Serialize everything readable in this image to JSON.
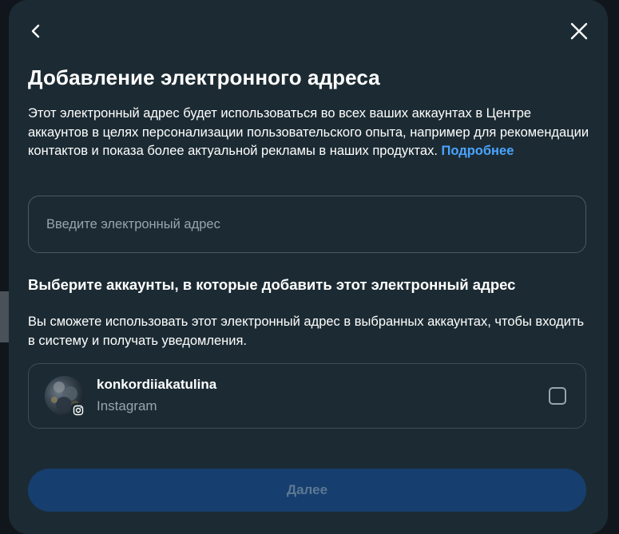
{
  "dialog": {
    "title": "Добавление электронного адреса",
    "description": "Этот электронный адрес будет использоваться во всех ваших аккаунтах в Центре аккаунтов в целях персонализации пользовательского опыта, например для рекомендации контактов и показа более актуальной рекламы в наших продуктах. ",
    "learn_more": "Подробнее",
    "email_placeholder": "Введите электронный адрес",
    "email_value": "",
    "section_title": "Выберите аккаунты, в которые добавить этот электронный адрес",
    "section_description": "Вы сможете использовать этот электронный адрес в выбранных аккаунтах, чтобы входить в систему и получать уведомления.",
    "accounts": [
      {
        "username": "konkordiiakatulina",
        "platform": "Instagram",
        "checked": false
      }
    ],
    "next_label": "Далее"
  },
  "icons": {
    "back": "chevron-left-icon",
    "close": "close-icon",
    "account_badge": "instagram-icon"
  },
  "colors": {
    "modal_bg": "#1c2b33",
    "link": "#4aa4ff",
    "button_disabled_bg": "#163e6e",
    "button_disabled_text": "#5d7894"
  }
}
